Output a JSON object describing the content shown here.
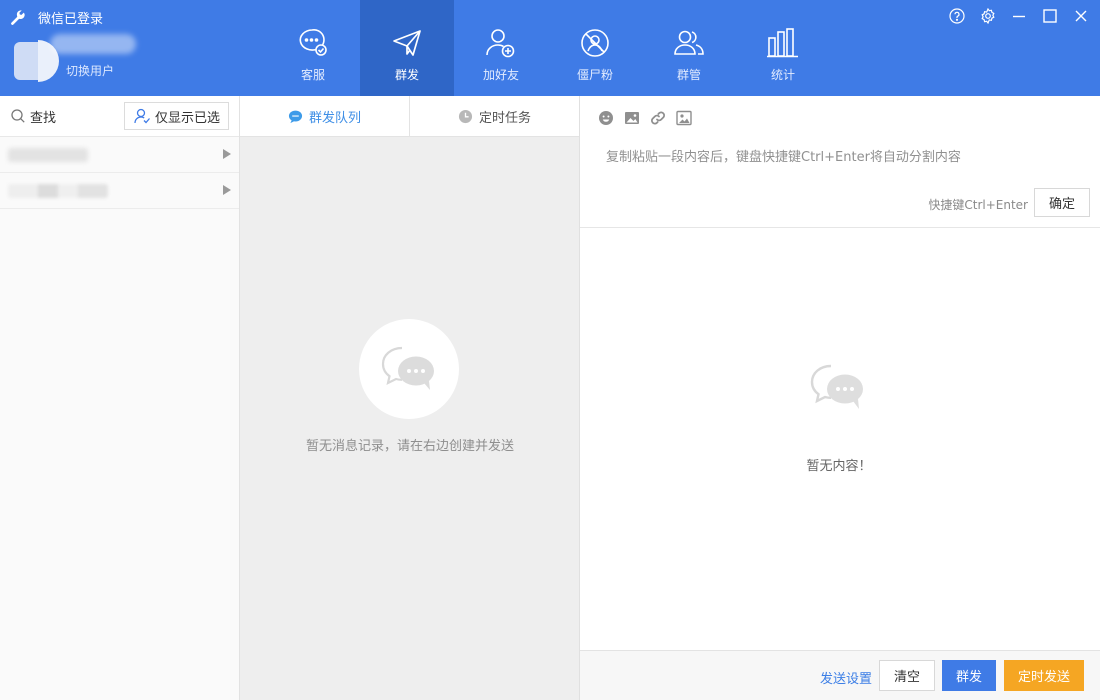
{
  "header": {
    "title": "微信已登录",
    "switch_user": "切换用户",
    "nav": [
      {
        "label": "客服",
        "icon": "chat-check-icon",
        "active": false
      },
      {
        "label": "群发",
        "icon": "paper-plane-icon",
        "active": true
      },
      {
        "label": "加好友",
        "icon": "add-friend-icon",
        "active": false
      },
      {
        "label": "僵尸粉",
        "icon": "zombie-fan-icon",
        "active": false
      },
      {
        "label": "群管",
        "icon": "group-manage-icon",
        "active": false
      },
      {
        "label": "统计",
        "icon": "bar-stats-icon",
        "active": false
      }
    ],
    "window_controls": [
      "help-icon",
      "settings-icon",
      "minimize-icon",
      "maximize-icon",
      "close-icon"
    ]
  },
  "left": {
    "search_label": "查找",
    "only_selected_label": "仅显示已选"
  },
  "middle": {
    "tabs": [
      {
        "label": "群发队列",
        "icon": "chat-bubble-icon"
      },
      {
        "label": "定时任务",
        "icon": "clock-icon"
      }
    ],
    "empty_message": "暂无消息记录，请在右边创建并发送"
  },
  "right": {
    "toolbar": [
      "emoji-icon",
      "image-icon",
      "link-icon",
      "picture-card-icon"
    ],
    "editor_placeholder": "复制粘贴一段内容后，键盘快捷键Ctrl+Enter将自动分割内容",
    "shortcut_hint": "快捷键Ctrl+Enter",
    "confirm_label": "确定",
    "empty_content": "暂无内容！",
    "bottom": {
      "send_settings": "发送设置",
      "clear": "清空",
      "mass_send": "群发",
      "timed_send": "定时发送"
    }
  },
  "colors": {
    "header_bg": "#3f7be6",
    "active_tab_bg": "#2f66c7",
    "link_blue": "#3b7ee6",
    "timed_orange": "#f5a623"
  }
}
